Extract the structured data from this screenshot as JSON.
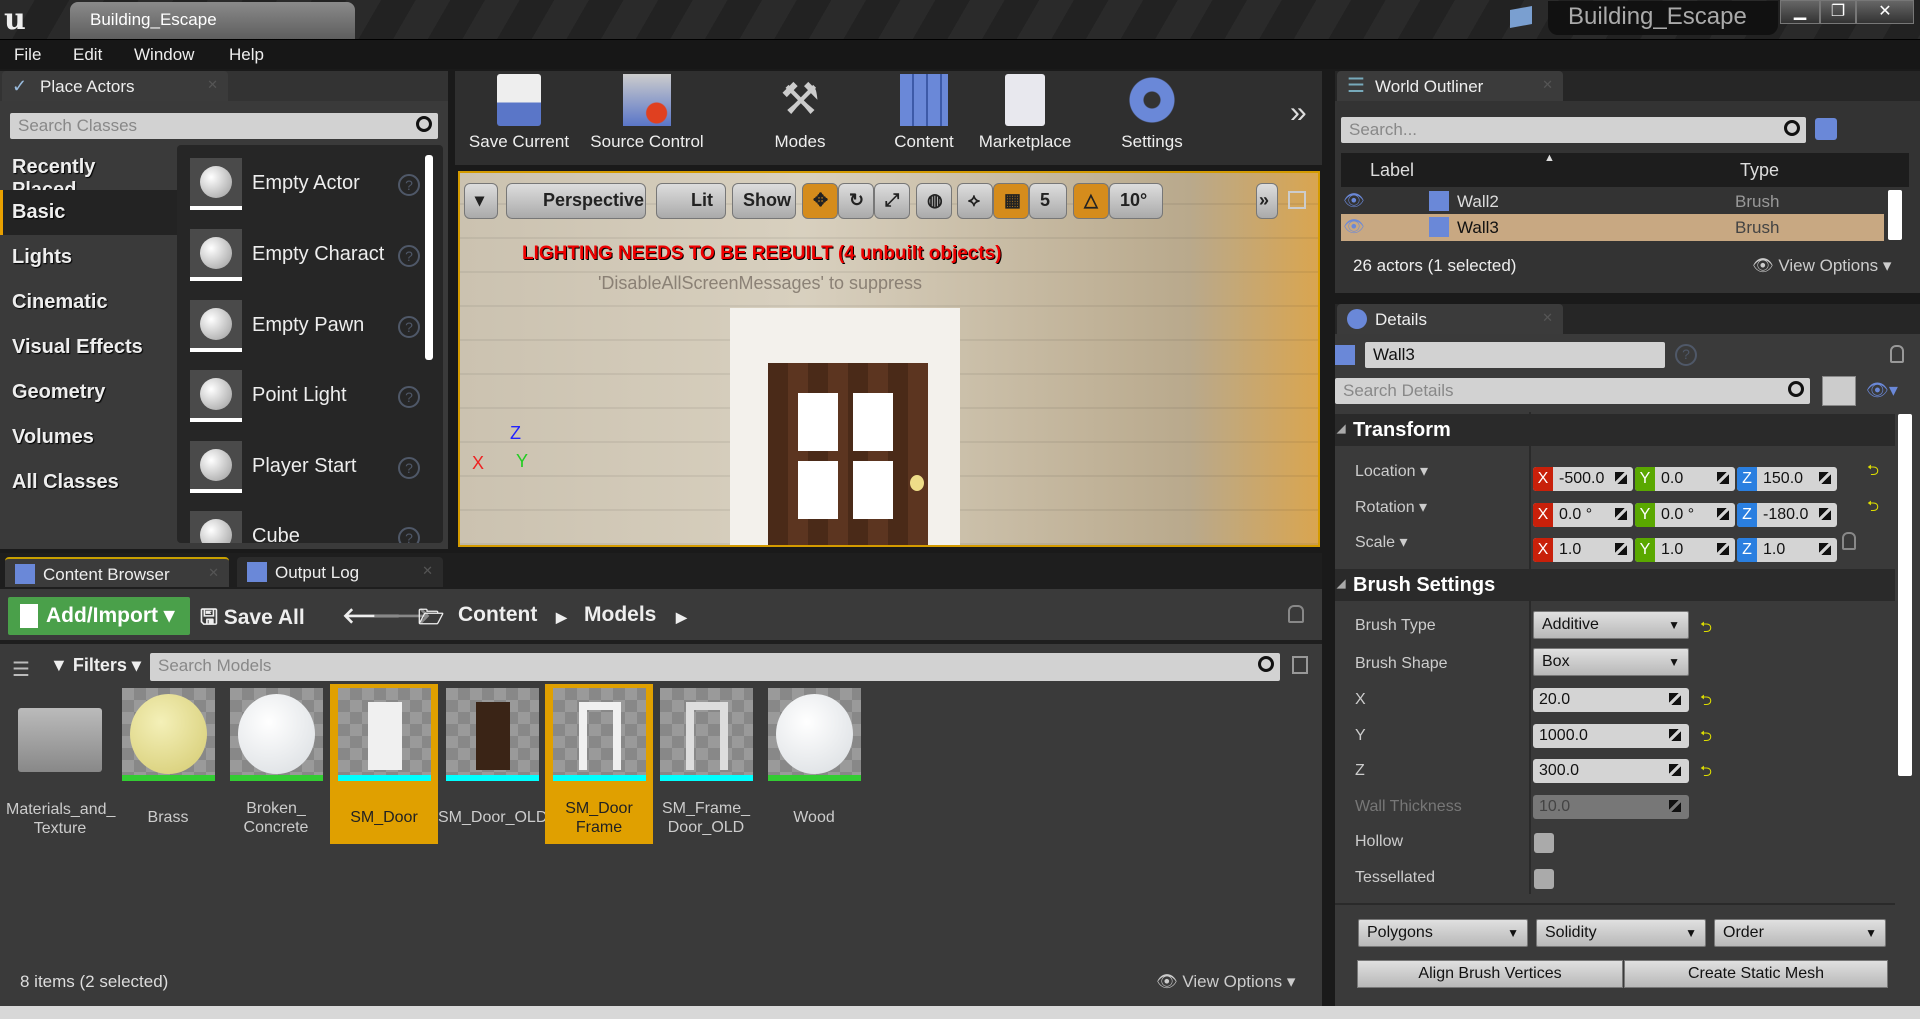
{
  "window": {
    "tab_title": "Building_Escape",
    "project_title": "Building_Escape",
    "minimize": "▁",
    "restore": "❐",
    "close": "✕"
  },
  "menu": [
    "File",
    "Edit",
    "Window",
    "Help"
  ],
  "place_actors": {
    "tab": "Place Actors",
    "search_placeholder": "Search Classes",
    "categories": [
      "Recently Placed",
      "Basic",
      "Lights",
      "Cinematic",
      "Visual Effects",
      "Geometry",
      "Volumes",
      "All Classes"
    ],
    "selected_category": "Basic",
    "items": [
      "Empty Actor",
      "Empty Charact",
      "Empty Pawn",
      "Point Light",
      "Player Start",
      "Cube"
    ]
  },
  "toolbar": {
    "buttons": [
      "Save Current",
      "Source Control",
      "Modes",
      "Content",
      "Marketplace",
      "Settings"
    ],
    "more": "»"
  },
  "viewport": {
    "perspective": "Perspective",
    "lit": "Lit",
    "show": "Show",
    "grid_snap": "5",
    "rot_snap": "10°",
    "warning": "LIGHTING NEEDS TO BE REBUILT (4 unbuilt objects)",
    "suppress": "'DisableAllScreenMessages' to suppress",
    "axes": {
      "x": "X",
      "y": "Y",
      "z": "Z"
    }
  },
  "content_browser": {
    "tab": "Content Browser",
    "tab2": "Output Log",
    "add_import": "Add/Import",
    "save_all": "Save All",
    "path": [
      "Content",
      "Models"
    ],
    "filters": "Filters",
    "search_placeholder": "Search Models",
    "assets": [
      {
        "name": "Materials_and_ Texture"
      },
      {
        "name": "Brass"
      },
      {
        "name": "Broken_ Concrete"
      },
      {
        "name": "SM_Door"
      },
      {
        "name": "SM_Door_OLD"
      },
      {
        "name": "SM_Door Frame"
      },
      {
        "name": "SM_Frame_ Door_OLD"
      },
      {
        "name": "Wood"
      }
    ],
    "status": "8 items (2 selected)",
    "view_options": "View Options"
  },
  "outliner": {
    "tab": "World Outliner",
    "search_placeholder": "Search...",
    "col_label": "Label",
    "col_type": "Type",
    "rows": [
      {
        "label": "Wall2",
        "type": "Brush"
      },
      {
        "label": "Wall3",
        "type": "Brush"
      }
    ],
    "status": "26 actors (1 selected)",
    "view_options": "View Options"
  },
  "details": {
    "tab": "Details",
    "name": "Wall3",
    "search_placeholder": "Search Details",
    "transform": {
      "header": "Transform",
      "location_label": "Location",
      "rotation_label": "Rotation",
      "scale_label": "Scale",
      "location": [
        "-500.0",
        "0.0",
        "150.0"
      ],
      "rotation": [
        "0.0 °",
        "0.0 °",
        "-180.0"
      ],
      "scale": [
        "1.0",
        "1.0",
        "1.0"
      ]
    },
    "brush": {
      "header": "Brush Settings",
      "type_label": "Brush Type",
      "type": "Additive",
      "shape_label": "Brush Shape",
      "shape": "Box",
      "x_label": "X",
      "x": "20.0",
      "y_label": "Y",
      "y": "1000.0",
      "z_label": "Z",
      "z": "300.0",
      "wall_label": "Wall Thickness",
      "wall": "10.0",
      "hollow_label": "Hollow",
      "tess_label": "Tessellated"
    },
    "dropdowns": [
      "Polygons",
      "Solidity",
      "Order"
    ],
    "align": "Align Brush Vertices",
    "create_mesh": "Create Static Mesh"
  },
  "colors": {
    "accent": "#e0a000",
    "x": "#c8200a",
    "y": "#5aa800",
    "z": "#2a7fe0",
    "selected_row": "#c8a882",
    "green": "#4aa04a"
  }
}
